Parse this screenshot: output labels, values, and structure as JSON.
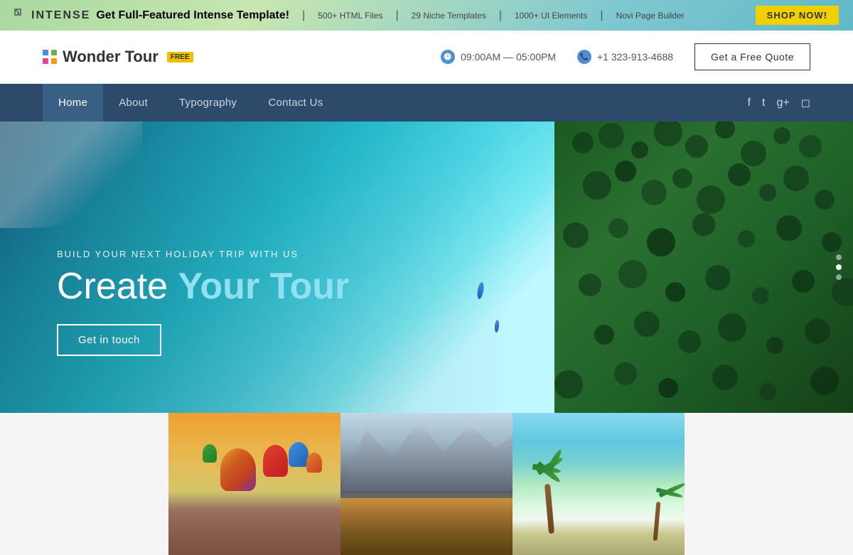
{
  "promo": {
    "logo_text": "INTENSE",
    "main_text": "Get Full-Featured Intense Template!",
    "tags": [
      "500+ HTML Files",
      "29 Niche Templates",
      "1000+ UI Elements",
      "Novi Page Builder"
    ],
    "shop_btn": "SHOP NOW!",
    "shop_now_label": "Shop Now!"
  },
  "header": {
    "logo_name": "Wonder Tour",
    "logo_badge": "FREE",
    "hours": "09:00AM — 05:00PM",
    "phone": "+1 323-913-4688",
    "quote_btn": "Get a Free Quote"
  },
  "nav": {
    "links": [
      {
        "label": "Home",
        "active": true
      },
      {
        "label": "About",
        "active": false
      },
      {
        "label": "Typography",
        "active": false
      },
      {
        "label": "Contact Us",
        "active": false
      }
    ],
    "social": [
      "f",
      "t",
      "g+",
      "in"
    ]
  },
  "hero": {
    "subtitle": "BUILD YOUR NEXT HOLIDAY TRIP WITH US",
    "title_plain": "Create ",
    "title_bold": "Your Tour",
    "cta_btn": "Get in touch"
  },
  "gallery": {
    "images": [
      {
        "alt": "Hot air balloons over Cappadocia"
      },
      {
        "alt": "Mountain landscape"
      },
      {
        "alt": "Tropical beach with palm trees"
      }
    ]
  },
  "colors": {
    "nav_bg": "#2d4a6b",
    "accent": "#4a90d9",
    "hero_highlight": "#90e0f0",
    "promo_btn": "#f0d000"
  }
}
